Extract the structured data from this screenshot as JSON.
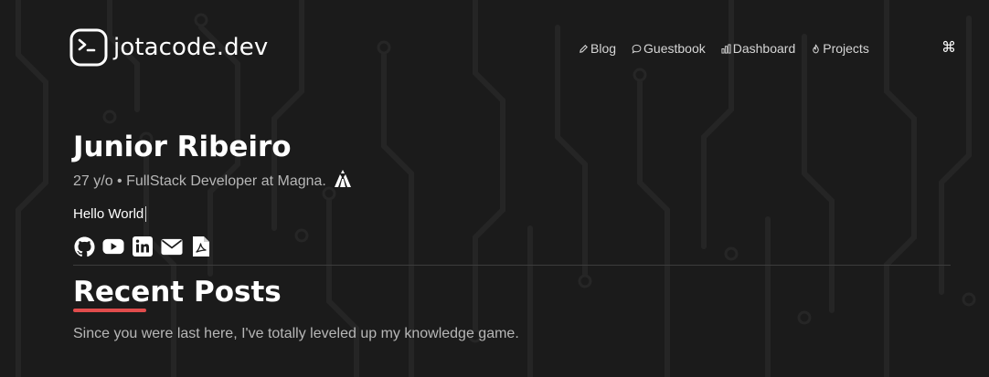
{
  "header": {
    "brand": "jotacode.dev",
    "nav": [
      {
        "label": "Blog",
        "icon": "pencil-icon"
      },
      {
        "label": "Guestbook",
        "icon": "chat-bubble-icon"
      },
      {
        "label": "Dashboard",
        "icon": "bar-chart-icon"
      },
      {
        "label": "Projects",
        "icon": "flame-icon"
      }
    ],
    "command_icon": "⌘"
  },
  "hero": {
    "name": "Junior Ribeiro",
    "subtitle": "27 y/o • FullStack Developer at Magna.",
    "typed_text": "Hello World",
    "socials": [
      "github-icon",
      "youtube-icon",
      "linkedin-icon",
      "email-icon",
      "pdf-resume-icon"
    ]
  },
  "recent_posts": {
    "title": "Recent Posts",
    "description": "Since you were last here, I've totally leveled up my knowledge game."
  },
  "colors": {
    "background": "#1b1b1b",
    "text": "#ffffff",
    "muted": "#b7b7b7",
    "accent": "#e04c4c"
  }
}
